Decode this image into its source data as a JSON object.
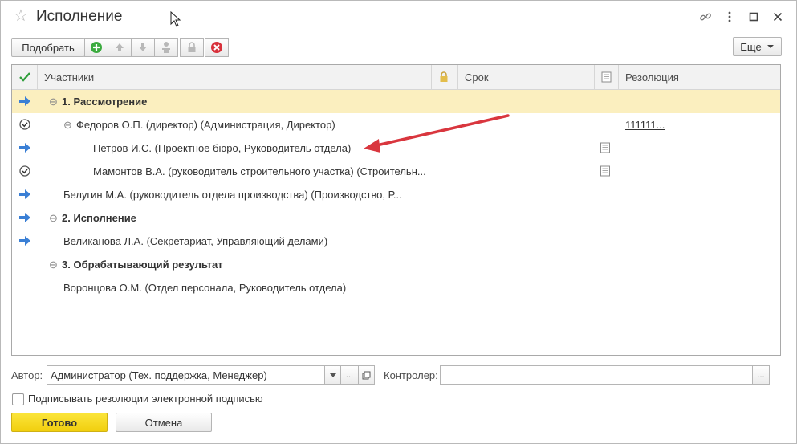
{
  "window": {
    "title": "Исполнение",
    "icons": [
      "star-icon",
      "link-icon",
      "more-vertical-icon",
      "maximize-icon",
      "close-icon"
    ]
  },
  "toolbar": {
    "pick_label": "Подобрать",
    "more_label": "Еще",
    "icons": [
      "add-icon",
      "move-up-icon",
      "move-down-icon",
      "person-icon",
      "lock-icon",
      "delete-icon"
    ]
  },
  "table": {
    "columns": {
      "participants": "Участники",
      "deadline": "Срок",
      "resolution": "Резолюция"
    },
    "rows": [
      {
        "status": "arrow",
        "level": 0,
        "group": true,
        "text": "1. Рассмотрение",
        "selected": true,
        "doc": false,
        "resolution": ""
      },
      {
        "status": "check",
        "level": 1,
        "group": true,
        "text": "Федоров О.П. (директор) (Администрация, Директор)",
        "selected": false,
        "doc": false,
        "resolution": "111111..."
      },
      {
        "status": "arrow",
        "level": 2,
        "group": false,
        "text": "Петров И.С. (Проектное бюро, Руководитель отдела)",
        "selected": false,
        "doc": true,
        "resolution": ""
      },
      {
        "status": "check",
        "level": 2,
        "group": false,
        "text": "Мамонтов В.А. (руководитель строительного участка) (Строительн...",
        "selected": false,
        "doc": true,
        "resolution": ""
      },
      {
        "status": "arrow",
        "level": 1,
        "group": false,
        "text": "Белугин М.А. (руководитель отдела производства) (Производство, Р...",
        "selected": false,
        "doc": false,
        "resolution": ""
      },
      {
        "status": "arrow",
        "level": 0,
        "group": true,
        "text": "2. Исполнение",
        "selected": false,
        "doc": false,
        "resolution": ""
      },
      {
        "status": "arrow",
        "level": 1,
        "group": false,
        "text": "Великанова Л.А. (Секретариат, Управляющий делами)",
        "selected": false,
        "doc": false,
        "resolution": ""
      },
      {
        "status": "none",
        "level": 0,
        "group": true,
        "text": "3. Обрабатывающий результат",
        "selected": false,
        "doc": false,
        "resolution": ""
      },
      {
        "status": "none",
        "level": 1,
        "group": false,
        "text": "Воронцова О.М. (Отдел персонала, Руководитель отдела)",
        "selected": false,
        "doc": false,
        "resolution": ""
      }
    ]
  },
  "form": {
    "author_label": "Автор:",
    "author_value": "Администратор (Тех. поддержка, Менеджер)",
    "controller_label": "Контролер:",
    "controller_value": "",
    "ellipsis": "...",
    "sign_label": "Подписывать резолюции электронной подписью",
    "sign_checked": false
  },
  "footer": {
    "ok_label": "Готово",
    "cancel_label": "Отмена"
  },
  "colors": {
    "accent_yellow": "#f5d81d",
    "selected_row": "#fbefbf",
    "arrow_blue": "#3a7fd5",
    "annotation_red": "#d9363e"
  }
}
